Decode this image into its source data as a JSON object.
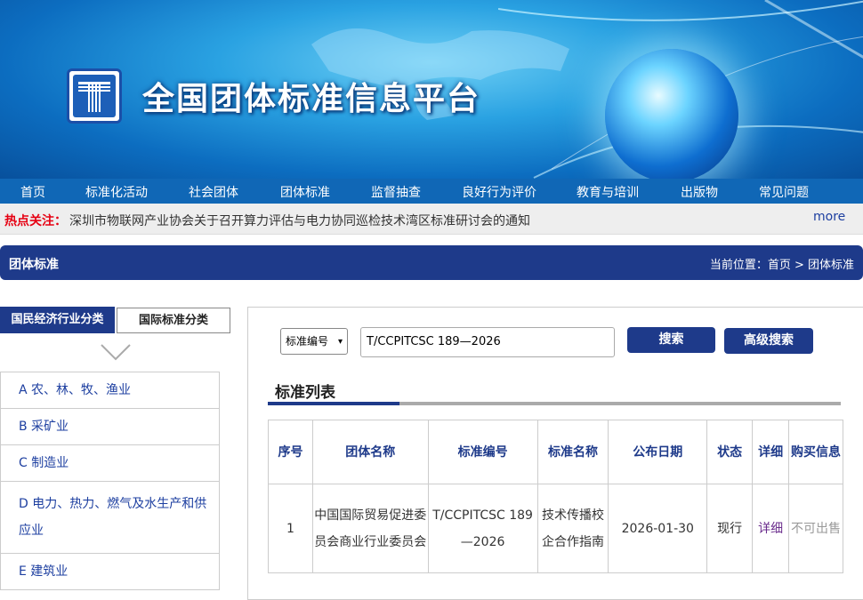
{
  "site": {
    "title": "全国团体标准信息平台"
  },
  "nav": [
    "首页",
    "标准化活动",
    "社会团体",
    "团体标准",
    "监督抽查",
    "良好行为评价",
    "教育与培训",
    "出版物",
    "常见问题"
  ],
  "hot": {
    "label": "热点关注：",
    "text": "深圳市物联网产业协会关于召开算力评估与电力协同巡检技术湾区标准研讨会的通知",
    "more": "more"
  },
  "section": {
    "title": "团体标准",
    "breadcrumb": "当前位置：首页 > 团体标准"
  },
  "left_tabs": {
    "active": "国民经济行业分类",
    "inactive": "国际标准分类"
  },
  "categories": [
    "A 农、林、牧、渔业",
    "B 采矿业",
    "C 制造业",
    "D 电力、热力、燃气及水生产和供应业",
    "E 建筑业"
  ],
  "search": {
    "select_value": "标准编号",
    "input_value": "T/CCPITCSC 189—2026",
    "search_button": "搜索",
    "advanced_button": "高级搜索"
  },
  "list": {
    "title": "标准列表",
    "headers": [
      "序号",
      "团体名称",
      "标准编号",
      "标准名称",
      "公布日期",
      "状态",
      "详细",
      "购买信息"
    ],
    "rows": [
      [
        "1",
        "中国国际贸易促进委员会商业行业委员会",
        "T/CCPITCSC 189—2026",
        "技术传播校企合作指南",
        "2026-01-30",
        "现行",
        "详细",
        "不可出售"
      ]
    ]
  },
  "colors": {
    "nav": "#1067b6",
    "header": "#1e3a8a",
    "hot_label": "#e60012"
  }
}
